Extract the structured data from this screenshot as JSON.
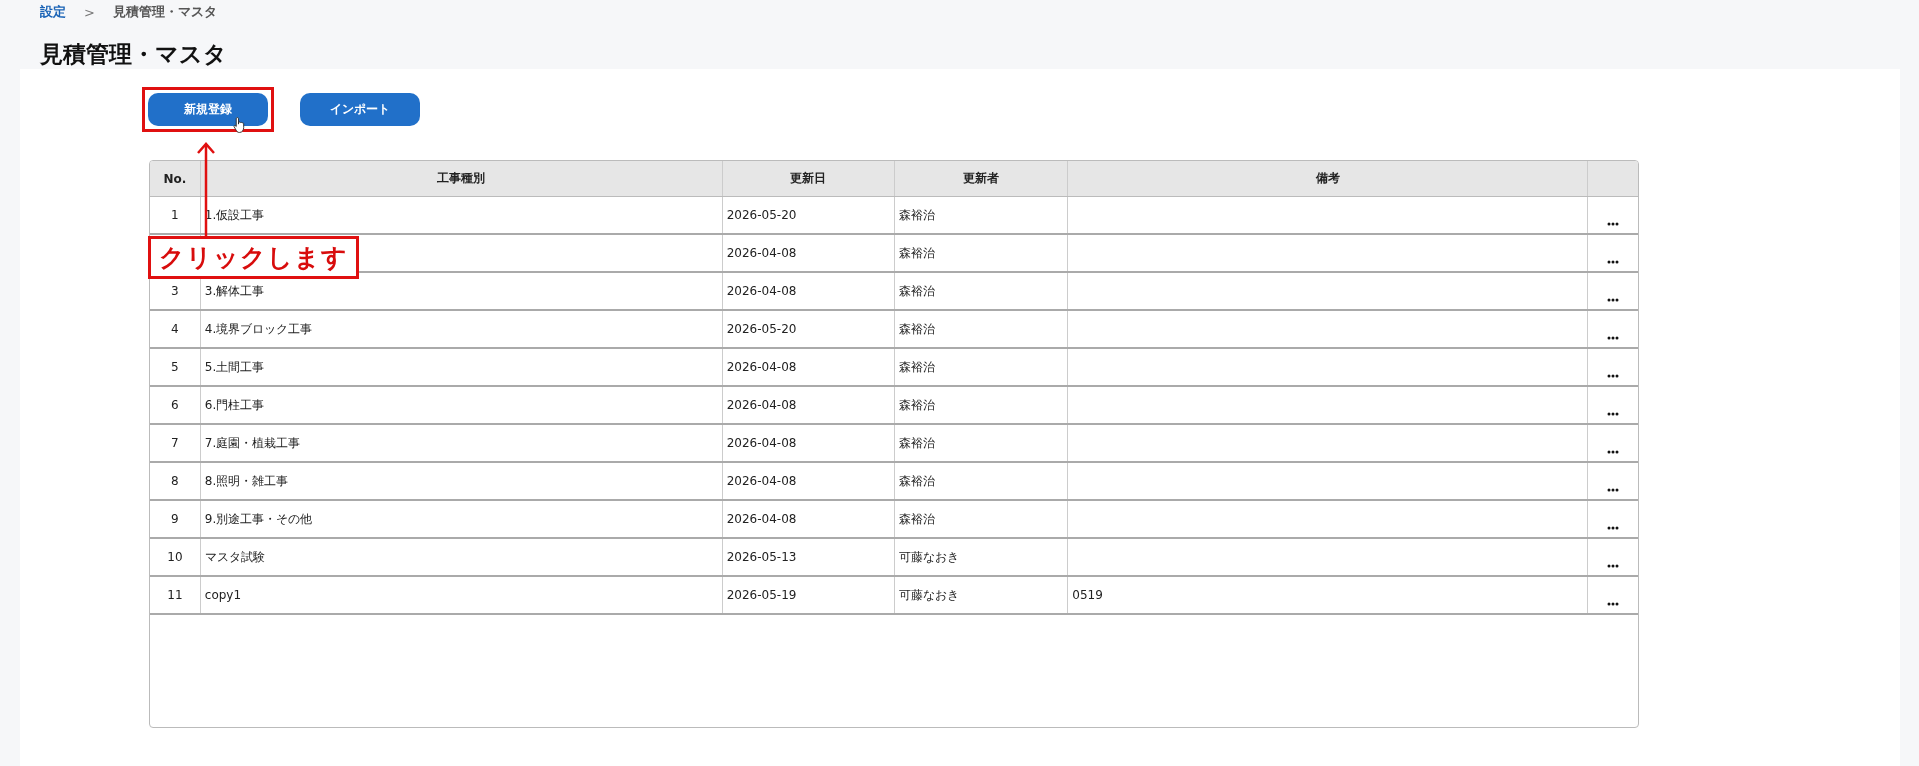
{
  "breadcrumb": [
    {
      "label": "設定",
      "kind": "link"
    },
    {
      "label": ">",
      "kind": "separator"
    },
    {
      "label": "見積管理・マスタ",
      "kind": "current"
    }
  ],
  "title": "見積管理・マスタ",
  "buttons": [
    {
      "label": "新規登録",
      "highlighted": true
    },
    {
      "label": "インポート",
      "highlighted": false
    }
  ],
  "annotation": {
    "text": "クリックします"
  },
  "table": {
    "columns": [
      "No.",
      "工事種別",
      "更新日",
      "更新者",
      "備考"
    ],
    "rows": [
      {
        "no": "1",
        "name": "1.仮設工事",
        "date": "2026-05-20",
        "user": "森裕治"
      },
      {
        "date": "2026-04-08",
        "user": "森裕治"
      },
      {
        "no": "3",
        "name": "3.解体工事",
        "date": "2026-04-08",
        "user": "森裕治"
      },
      {
        "no": "4",
        "name": "4.境界ブロック工事",
        "date": "2026-05-20",
        "user": "森裕治"
      },
      {
        "no": "5",
        "name": "5.土間工事",
        "date": "2026-04-08",
        "user": "森裕治"
      },
      {
        "no": "6",
        "name": "6.門柱工事",
        "date": "2026-04-08",
        "user": "森裕治"
      },
      {
        "no": "7",
        "name": "7.庭園・植栽工事",
        "date": "2026-04-08",
        "user": "森裕治"
      },
      {
        "no": "8",
        "name": "8.照明・雑工事",
        "date": "2026-04-08",
        "user": "森裕治"
      },
      {
        "no": "9",
        "name": "9.別途工事・その他",
        "date": "2026-04-08",
        "user": "森裕治"
      },
      {
        "no": "10",
        "name": "マスタ試験",
        "date": "2026-05-13",
        "user": "可藤なおき"
      },
      {
        "no": "11",
        "name": "copy1",
        "date": "2026-05-19",
        "user": "可藤なおき",
        "note": "0519"
      }
    ]
  }
}
